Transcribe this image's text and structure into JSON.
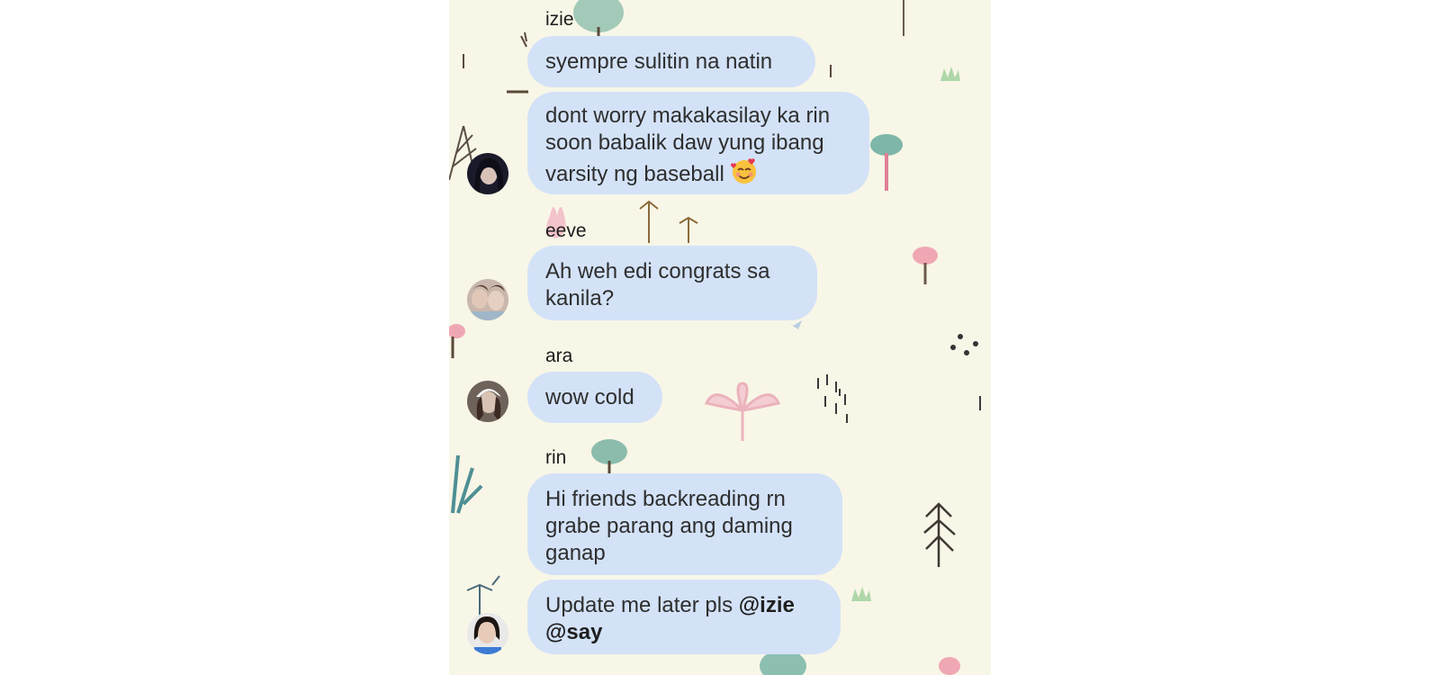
{
  "colors": {
    "background": "#f8f6e7",
    "bubble": "#d3e2f7",
    "text": "#2e2e2e"
  },
  "groups": [
    {
      "sender": "izie",
      "messages": [
        "syempre sulitin na natin",
        "dont worry makakasilay ka rin soon babalik daw yung ibang varsity ng baseball"
      ],
      "emoji": "smiling-face-with-hearts"
    },
    {
      "sender": "eeve",
      "messages": [
        "Ah weh edi congrats sa kanila?"
      ]
    },
    {
      "sender": "ara",
      "messages": [
        "wow cold"
      ]
    },
    {
      "sender": "rin",
      "messages": [
        "Hi friends backreading rn grabe parang ang daming ganap",
        "Update me later pls"
      ],
      "mentions": [
        "@izie",
        "@say"
      ]
    }
  ]
}
